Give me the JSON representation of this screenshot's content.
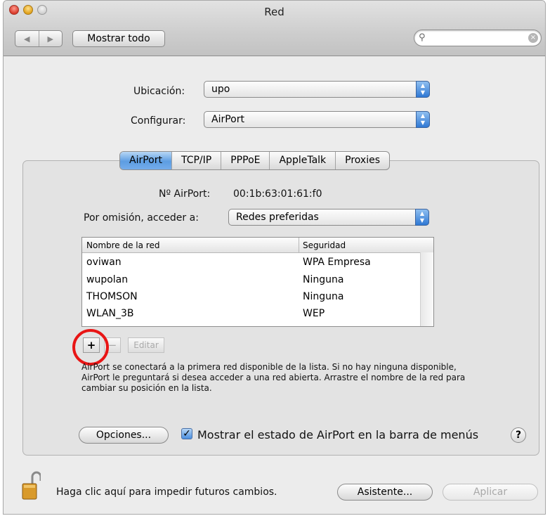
{
  "window": {
    "title": "Red"
  },
  "toolbar": {
    "back_icon": "◀",
    "forward_icon": "▶",
    "show_all_label": "Mostrar todo",
    "search_placeholder": "",
    "search_icon": "search-icon",
    "clear_icon": "clear-icon"
  },
  "location": {
    "label": "Ubicación:",
    "value": "upo"
  },
  "configure": {
    "label": "Configurar:",
    "value": "AirPort"
  },
  "tabs": [
    {
      "label": "AirPort",
      "selected": true
    },
    {
      "label": "TCP/IP",
      "selected": false
    },
    {
      "label": "PPPoE",
      "selected": false
    },
    {
      "label": "AppleTalk",
      "selected": false
    },
    {
      "label": "Proxies",
      "selected": false
    }
  ],
  "airport": {
    "id_label": "Nº AirPort:",
    "id_value": "00:1b:63:01:61:f0",
    "default_access_label": "Por omisión, acceder a:",
    "default_access_value": "Redes preferidas"
  },
  "networks": {
    "columns": [
      "Nombre de la red",
      "Seguridad"
    ],
    "rows": [
      [
        "oviwan",
        "WPA Empresa"
      ],
      [
        "wupolan",
        "Ninguna"
      ],
      [
        "THOMSON",
        "Ninguna"
      ],
      [
        "WLAN_3B",
        "WEP"
      ]
    ]
  },
  "list_buttons": {
    "add_label": "+",
    "remove_label": "−",
    "edit_label": "Editar"
  },
  "help_text": "AirPort se conectará a la primera red disponible de la lista. Si no hay ninguna disponible, AirPort le preguntará si desea acceder a una red abierta. Arrastre el nombre de la red para cambiar su posición en la lista.",
  "options_button": "Opciones...",
  "menu_status": {
    "label": "Mostrar el estado de AirPort en la barra de menús",
    "checked": true
  },
  "help_button": "?",
  "footer": {
    "lock_text": "Haga clic aquí para impedir futuros cambios.",
    "assistant_label": "Asistente...",
    "apply_label": "Aplicar"
  },
  "colors": {
    "accent": "#5d9de2",
    "highlight_ring": "#e81515"
  }
}
